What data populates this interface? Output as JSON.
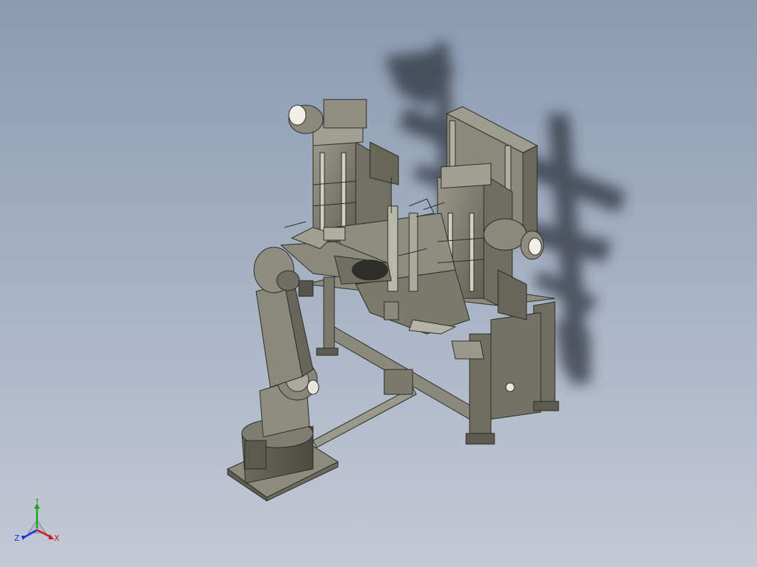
{
  "viewport": {
    "background_top": "#8a9bb1",
    "background_bottom": "#c3c9d6",
    "model_color": "#7e7e70",
    "shadow_color": "#2f3640"
  },
  "triad": {
    "x_label": "X",
    "y_label": "Y",
    "z_label": "Z",
    "x_color": "#d01818",
    "y_color": "#16a816",
    "z_color": "#1a2ee0"
  }
}
